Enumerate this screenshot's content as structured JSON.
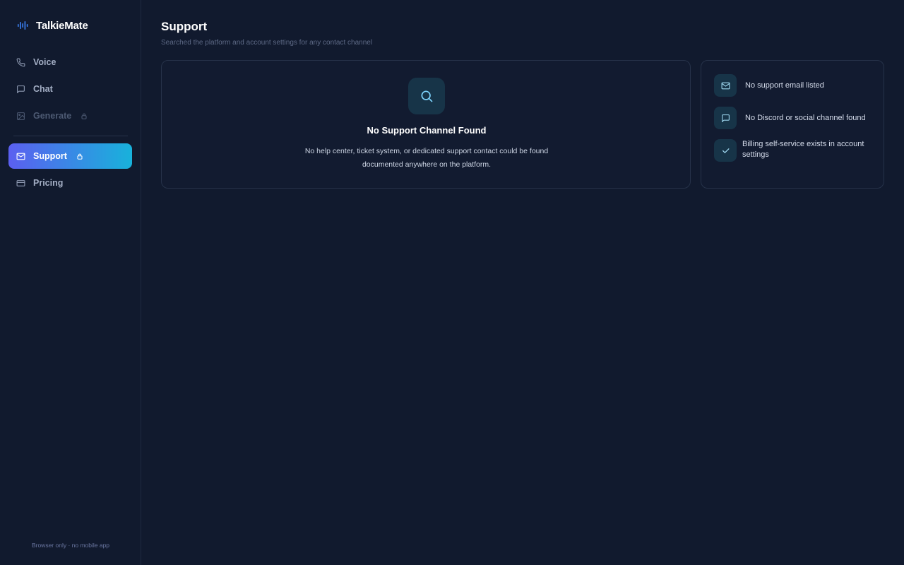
{
  "app": {
    "name": "TalkieMate"
  },
  "sidebar": {
    "items": [
      {
        "label": "Voice"
      },
      {
        "label": "Chat"
      },
      {
        "label": "Generate"
      }
    ],
    "items2": [
      {
        "label": "Support"
      },
      {
        "label": "Pricing"
      }
    ],
    "footer": "Browser only · no mobile app"
  },
  "page": {
    "title": "Support",
    "subtitle": "Searched the platform and account settings for any contact channel"
  },
  "main_card": {
    "icon": "search-icon",
    "title": "No Support Channel Found",
    "description": "No help center, ticket system, or dedicated support contact could be found documented anywhere on the platform."
  },
  "side_card": {
    "items": [
      {
        "icon": "mail-icon",
        "text": "No support email listed"
      },
      {
        "icon": "chat-bubble-icon",
        "text": "No Discord or social channel found"
      },
      {
        "icon": "check-icon",
        "text": "Billing self-service exists in account settings"
      }
    ]
  },
  "colors": {
    "background": "#111a2e",
    "accent_gradient_start": "#5b5ff0",
    "accent_gradient_end": "#18b2db",
    "icon_accent": "#3b82f6"
  }
}
